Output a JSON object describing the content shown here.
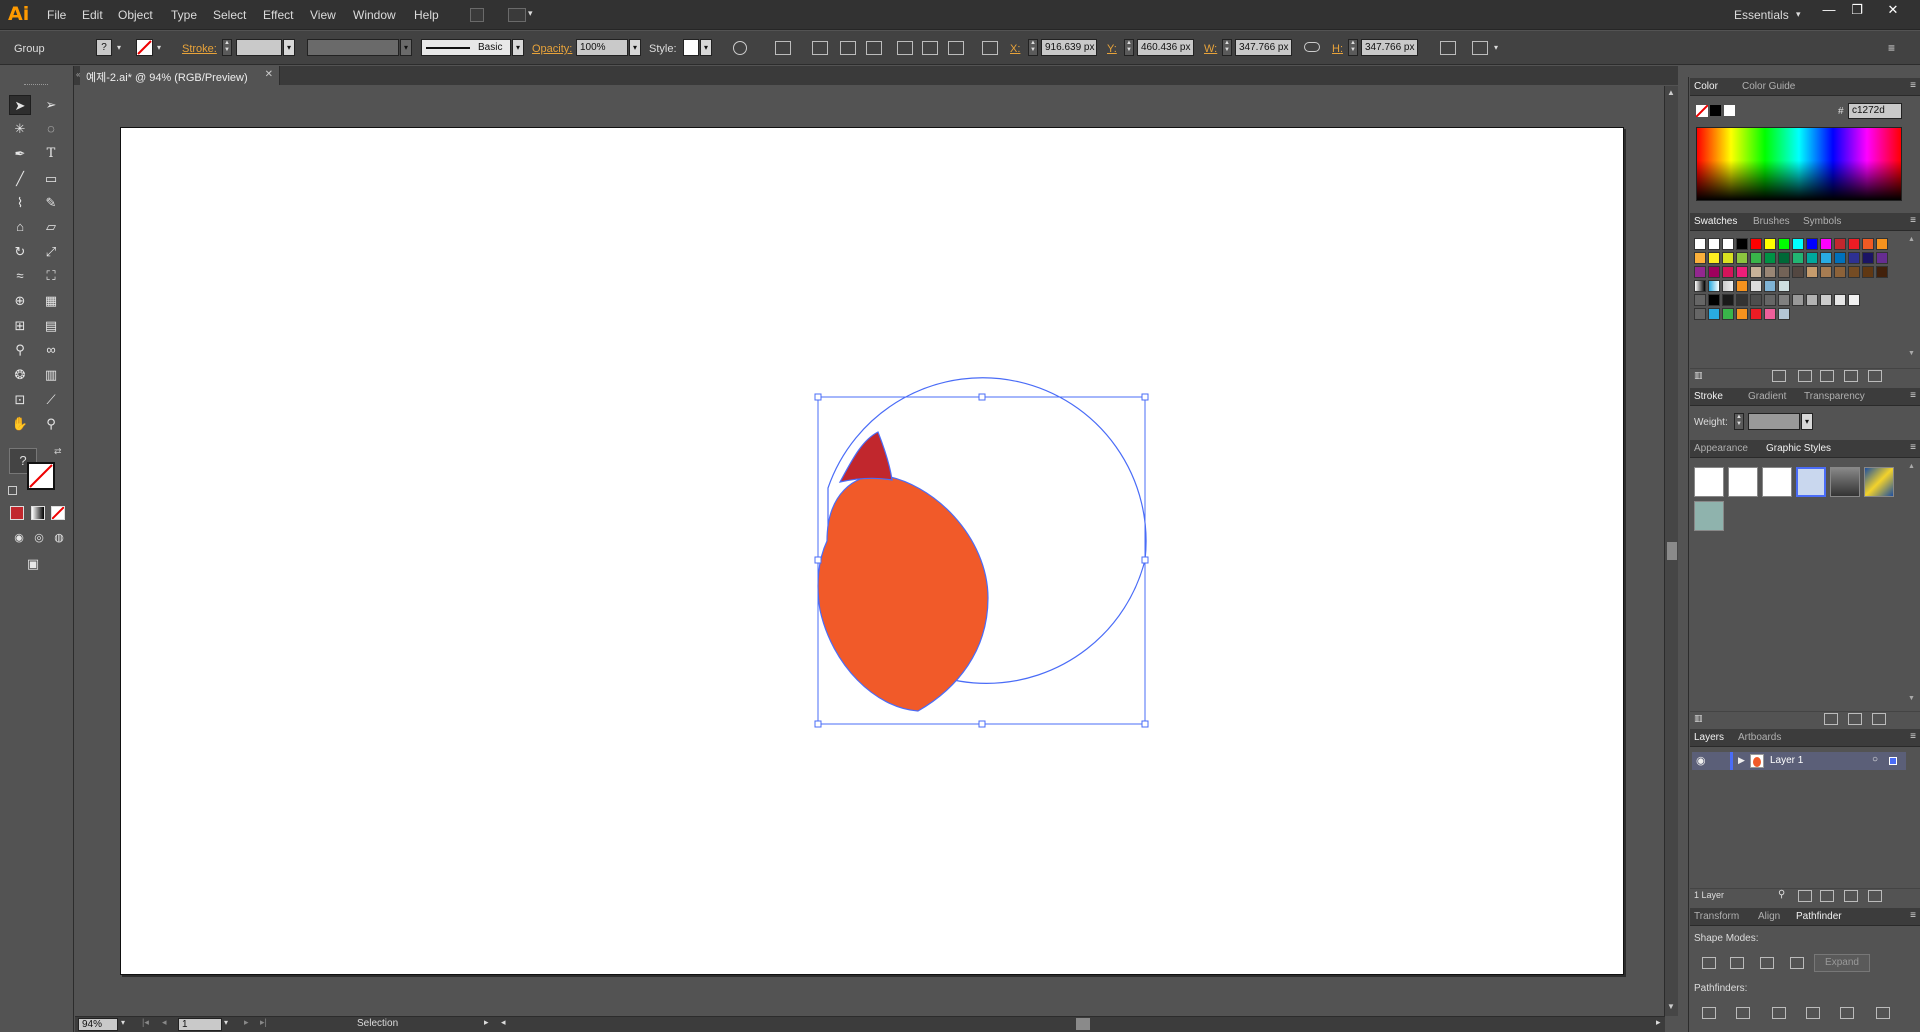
{
  "app": {
    "logo": "Ai"
  },
  "menu": [
    "File",
    "Edit",
    "Object",
    "Type",
    "Select",
    "Effect",
    "View",
    "Window",
    "Help"
  ],
  "workspace": {
    "label": "Essentials",
    "dropdown": "▾"
  },
  "window_controls": {
    "minimize": "—",
    "restore": "❐",
    "close": "✕"
  },
  "control_bar": {
    "selection_type": "Group",
    "fill_label": "?",
    "stroke_label": "Stroke:",
    "brush_label": "Basic",
    "opacity_label": "Opacity:",
    "opacity_value": "100%",
    "style_label": "Style:",
    "x_label": "X:",
    "x_value": "916.639 px",
    "y_label": "Y:",
    "y_value": "460.436 px",
    "w_label": "W:",
    "w_value": "347.766 px",
    "h_label": "H:",
    "h_value": "347.766 px"
  },
  "document": {
    "tab_title": "예제-2.ai* @ 94% (RGB/Preview)",
    "close": "✕"
  },
  "status_bar": {
    "zoom": "94%",
    "artboard_num": "1",
    "tool_name": "Selection"
  },
  "panels": {
    "color": {
      "tabs": [
        "Color",
        "Color Guide"
      ],
      "hex_label": "#",
      "hex_value": "c1272d"
    },
    "swatches": {
      "tabs": [
        "Swatches",
        "Brushes",
        "Symbols"
      ]
    },
    "stroke": {
      "tabs": [
        "Stroke",
        "Gradient",
        "Transparency"
      ],
      "weight_label": "Weight:"
    },
    "appearance": {
      "tabs": [
        "Appearance",
        "Graphic Styles"
      ]
    },
    "layers": {
      "tabs": [
        "Layers",
        "Artboards"
      ],
      "layer_name": "Layer 1",
      "footer_count": "1 Layer"
    },
    "pathfinder": {
      "tabs": [
        "Transform",
        "Align",
        "Pathfinder"
      ],
      "shape_modes_label": "Shape Modes:",
      "expand_label": "Expand",
      "pathfinders_label": "Pathfinders:"
    }
  },
  "colors": {
    "accent_orange": "#f15a29",
    "dark_red": "#c1272d",
    "selection_blue": "#4a6cf7",
    "ui_bg": "#535353"
  }
}
